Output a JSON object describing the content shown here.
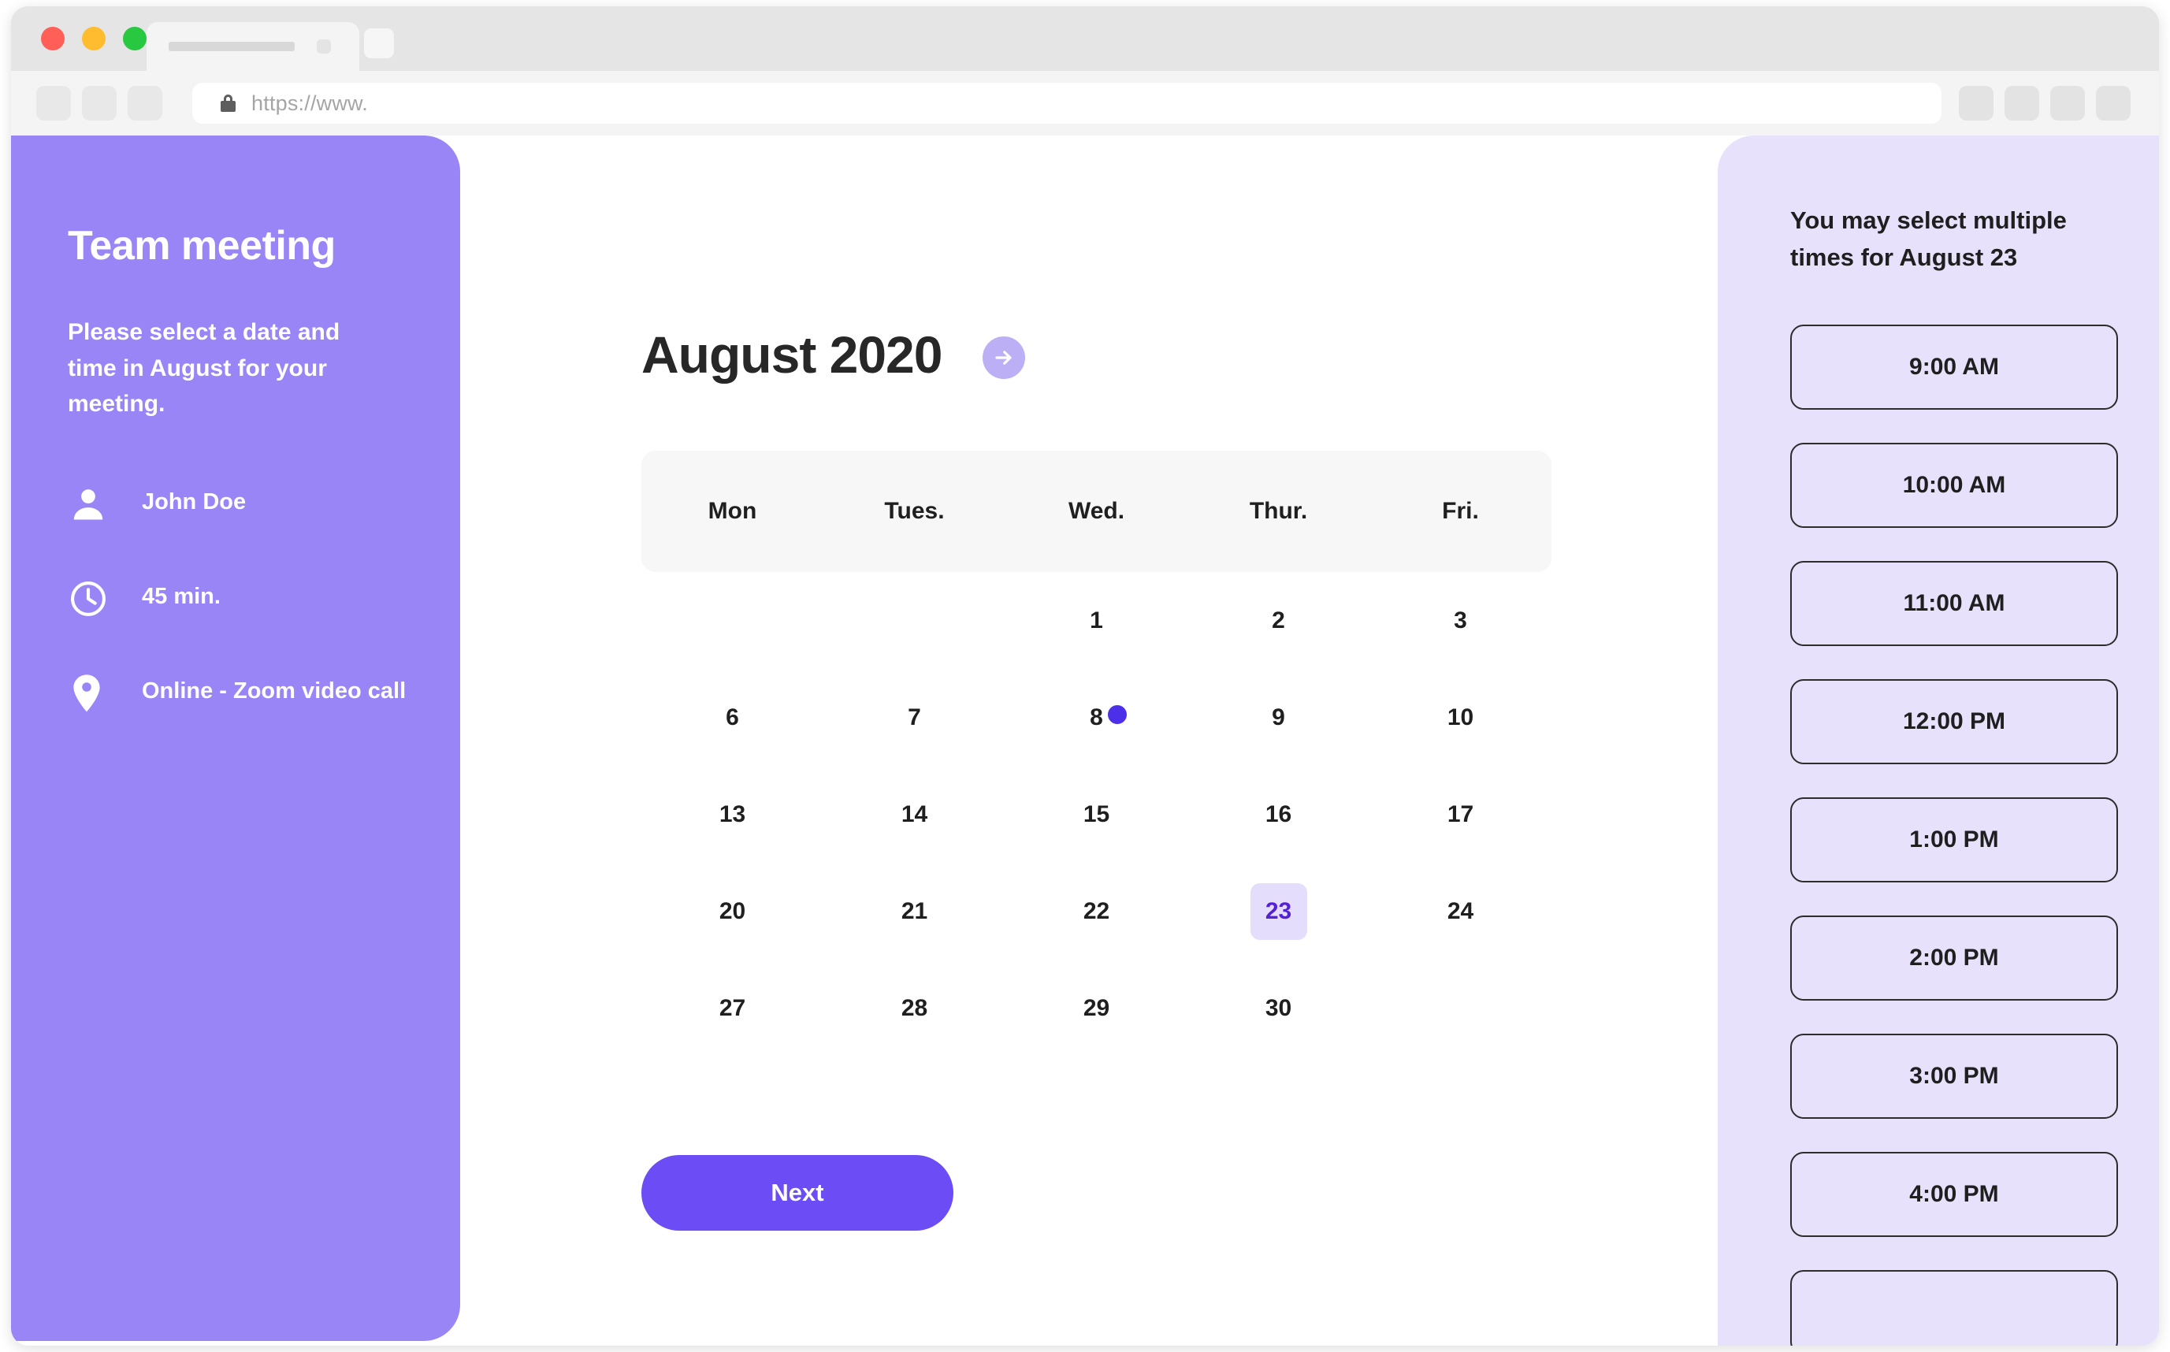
{
  "browser": {
    "tab": {
      "close_icon": "close-icon",
      "new_tab_icon": "plus-icon"
    },
    "url_text": "https://www.",
    "lock_icon": "lock-icon",
    "nav_buttons": [
      "back-button",
      "forward-button",
      "reload-button"
    ],
    "toolbar_right_buttons": [
      "extension-button-1",
      "extension-button-2",
      "extension-button-3",
      "profile-button"
    ],
    "traffic_lights": [
      "close",
      "minimize",
      "maximize"
    ]
  },
  "sidebar": {
    "title": "Team meeting",
    "description": "Please select a date and time in August for your meeting.",
    "info": [
      {
        "icon": "person-icon",
        "label": "John Doe"
      },
      {
        "icon": "clock-icon",
        "label": "45 min."
      },
      {
        "icon": "location-pin-icon",
        "label": "Online - Zoom video call"
      }
    ],
    "background_color": "#9A85F7"
  },
  "calendar": {
    "title": "August 2020",
    "next_month_icon": "arrow-right-icon",
    "day_names": [
      "Mon",
      "Tues.",
      "Wed.",
      "Thur.",
      "Fri."
    ],
    "weeks": [
      [
        {
          "day": ""
        },
        {
          "day": ""
        },
        {
          "day": "1"
        },
        {
          "day": "2"
        },
        {
          "day": "3"
        }
      ],
      [
        {
          "day": "6"
        },
        {
          "day": "7"
        },
        {
          "day": "8",
          "dot": true
        },
        {
          "day": "9"
        },
        {
          "day": "10"
        }
      ],
      [
        {
          "day": "13"
        },
        {
          "day": "14"
        },
        {
          "day": "15"
        },
        {
          "day": "16"
        },
        {
          "day": "17"
        }
      ],
      [
        {
          "day": "20"
        },
        {
          "day": "21"
        },
        {
          "day": "22"
        },
        {
          "day": "23",
          "selected": true
        },
        {
          "day": "24"
        }
      ],
      [
        {
          "day": "27"
        },
        {
          "day": "28"
        },
        {
          "day": "29"
        },
        {
          "day": "30"
        },
        {
          "day": ""
        }
      ]
    ],
    "selected_day": "23",
    "next_label": "Next",
    "accent_color": "#6C4CF5",
    "selected_bg_color": "#E4DDFC",
    "selected_text_color": "#5521D6",
    "dot_color": "#4C2FE8"
  },
  "times_panel": {
    "heading": "You may select multiple times for August 23",
    "slots": [
      "9:00 AM",
      "10:00 AM",
      "11:00 AM",
      "12:00 PM",
      "1:00 PM",
      "2:00 PM",
      "3:00 PM",
      "4:00 PM",
      ""
    ],
    "background_color": "#E7E1FB"
  }
}
